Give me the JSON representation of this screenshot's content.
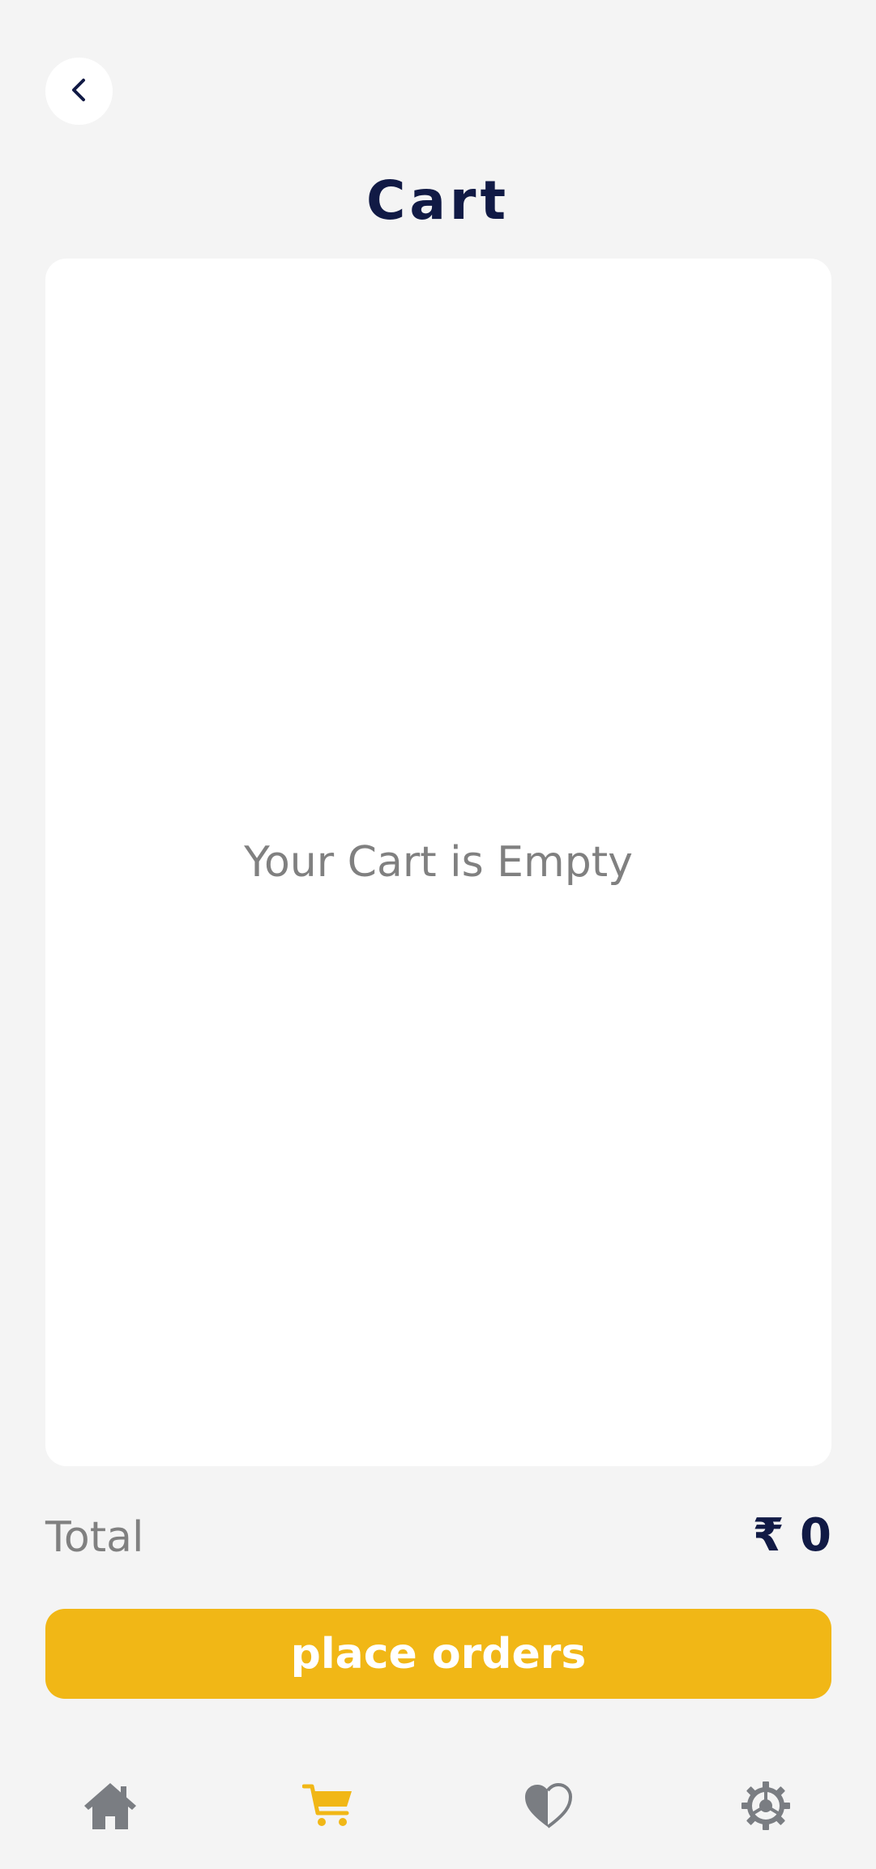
{
  "header": {
    "back_icon": "chevron-left-icon",
    "title": "Cart"
  },
  "cart": {
    "empty_message": "Your Cart is Empty"
  },
  "summary": {
    "total_label": "Total",
    "total_value": "₹ 0"
  },
  "actions": {
    "place_orders_label": "place orders"
  },
  "bottom_nav": {
    "items": [
      {
        "icon": "home-icon",
        "active": false
      },
      {
        "icon": "cart-icon",
        "active": true
      },
      {
        "icon": "heart-icon",
        "active": false
      },
      {
        "icon": "gear-icon",
        "active": false
      }
    ]
  },
  "colors": {
    "accent": "#f1b716",
    "title": "#111a45",
    "inactive_icon": "#7a7d82",
    "background": "#f4f4f4"
  }
}
